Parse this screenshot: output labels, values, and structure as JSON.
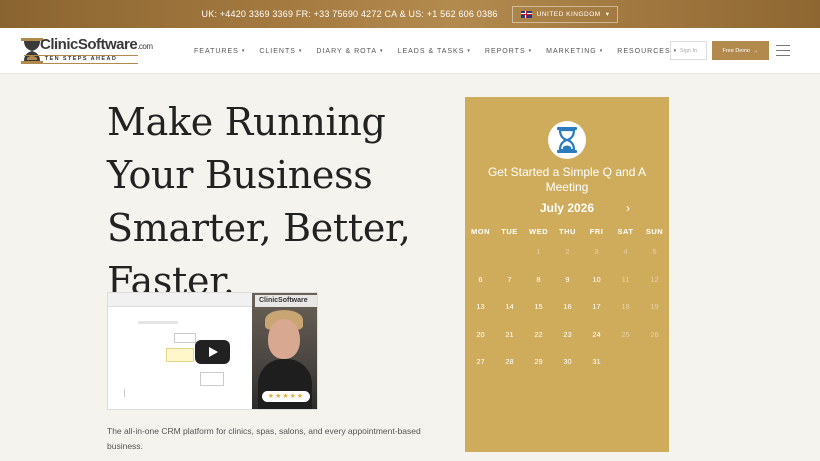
{
  "topbar": {
    "phones": "UK: +4420 3369 3369  FR: +33 75690 4272  CA & US: +1 562 606 0386",
    "country": "UNITED KINGDOM",
    "country_caret": "▾"
  },
  "logo": {
    "name": "ClinicSoftware",
    "suffix": ".com",
    "tagline": "TEN STEPS AHEAD"
  },
  "nav": {
    "items": [
      {
        "label": "FEATURES"
      },
      {
        "label": "CLIENTS"
      },
      {
        "label": "DIARY & ROTA"
      },
      {
        "label": "LEADS & TASKS"
      },
      {
        "label": "REPORTS"
      },
      {
        "label": "MARKETING"
      },
      {
        "label": "RESOURCES"
      }
    ],
    "caret": "▾",
    "signin": "Sign In",
    "demo": "Free Demo",
    "demo_caret": "→"
  },
  "hero": {
    "title_lines": [
      "Make Running",
      "Your Business",
      "Smarter, Better,",
      "Faster."
    ],
    "description": "The all-in-one CRM platform for clinics, spas, salons, and every appointment-based business."
  },
  "video": {
    "brand": "ClinicSoftware",
    "rating": "★★★★★"
  },
  "booking": {
    "title": "Get Started a Simple Q and A Meeting",
    "month": "July 2026",
    "next_icon": "›",
    "weekdays": [
      "MON",
      "TUE",
      "WED",
      "THU",
      "FRI",
      "SAT",
      "SUN"
    ],
    "weeks": [
      [
        "",
        "",
        "1",
        "2",
        "3",
        "4",
        "5"
      ],
      [
        "6",
        "7",
        "8",
        "9",
        "10",
        "11",
        "12"
      ],
      [
        "13",
        "14",
        "15",
        "16",
        "17",
        "18",
        "19"
      ],
      [
        "20",
        "21",
        "22",
        "23",
        "24",
        "25",
        "26"
      ],
      [
        "27",
        "28",
        "29",
        "30",
        "31",
        "",
        ""
      ]
    ],
    "faded_days": [
      "1",
      "2",
      "3",
      "4",
      "5",
      "11",
      "12",
      "18",
      "19",
      "25",
      "26"
    ]
  },
  "colors": {
    "gold": "#cfac5c",
    "topbar": "#a47a40",
    "demo_button": "#b38a4e"
  }
}
